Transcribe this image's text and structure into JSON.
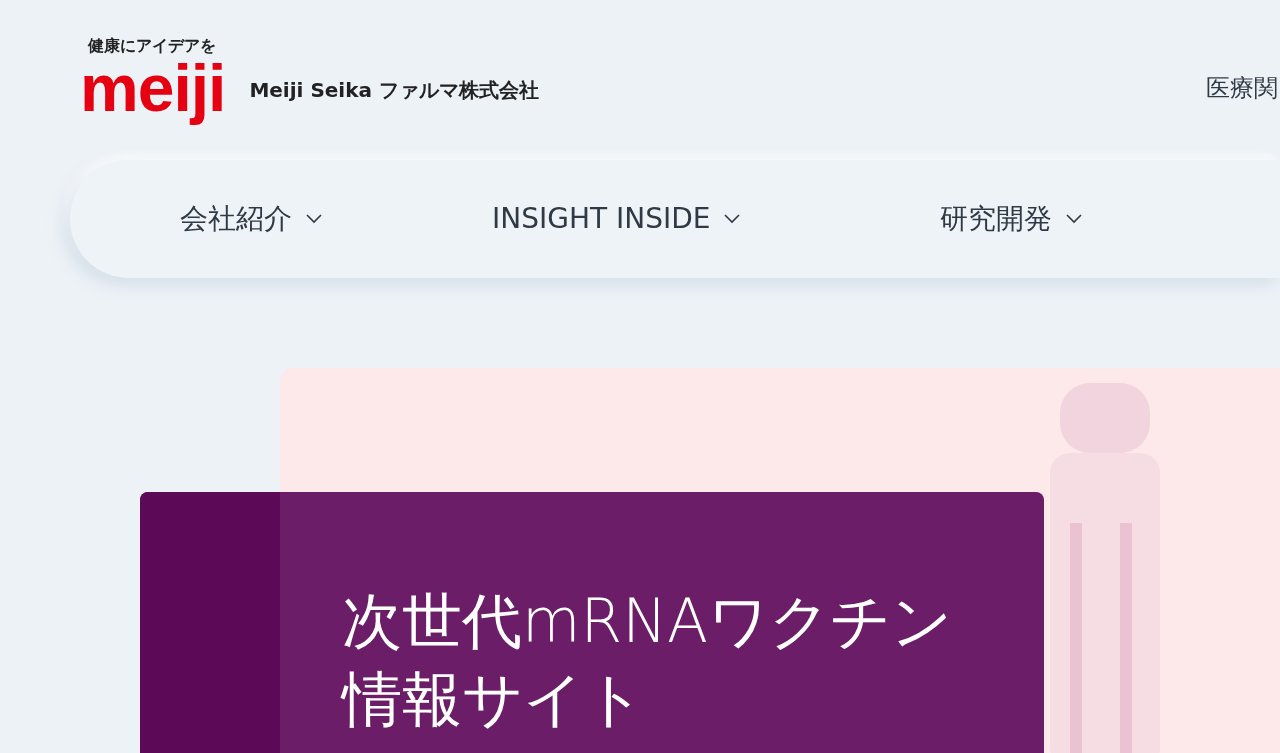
{
  "header": {
    "tagline": "健康にアイデアを",
    "logo": "meiji",
    "company": "Meiji Seika ファルマ株式会社",
    "top_link": "医療関"
  },
  "nav": {
    "items": [
      {
        "label": "会社紹介",
        "has_dropdown": true
      },
      {
        "label": "INSIGHT INSIDE",
        "has_dropdown": true
      },
      {
        "label": "研究開発",
        "has_dropdown": true
      }
    ]
  },
  "hero": {
    "title": "次世代mRNAワクチン情報サイト"
  }
}
